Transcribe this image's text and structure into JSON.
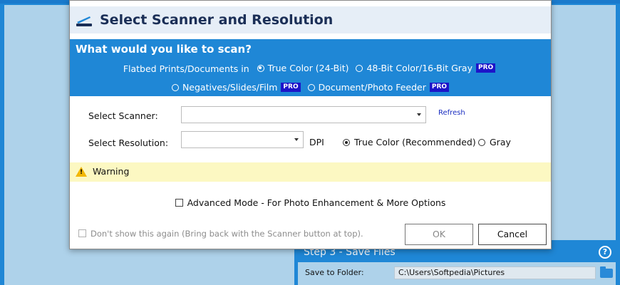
{
  "background": {
    "step3_title": "Step 3 - Save Files",
    "help_glyph": "?",
    "save_label": "Save to Folder:",
    "save_path": "C:\\Users\\Softpedia\\Pictures"
  },
  "dialog": {
    "title": "Select Scanner and Resolution",
    "question": "What would you like to scan?",
    "flatbed_lead": "Flatbed Prints/Documents in",
    "options": {
      "true_color_24": "True Color (24-Bit)",
      "bit48": "48-Bit Color/16-Bit Gray",
      "negatives": "Negatives/Slides/Film",
      "feeder": "Document/Photo Feeder",
      "pro": "PRO"
    },
    "selected_scan_mode": "True Color (24-Bit)",
    "scanner_label": "Select Scanner:",
    "scanner_value": "",
    "refresh": "Refresh",
    "resolution_label": "Select Resolution:",
    "resolution_value": "",
    "dpi": "DPI",
    "color_true": "True Color (Recommended)",
    "color_gray": "Gray",
    "selected_color": "True Color (Recommended)",
    "warning": "Warning",
    "advanced": "Advanced Mode - For Photo Enhancement & More Options",
    "dont_show": "Don't show this again (Bring back with the Scanner button at top).",
    "ok": "OK",
    "cancel": "Cancel"
  },
  "colors": {
    "accent_blue": "#1f87d6",
    "header_bg": "#e6eef7",
    "warning_bg": "#fcf8c2",
    "pro_badge": "#1d14c9"
  }
}
